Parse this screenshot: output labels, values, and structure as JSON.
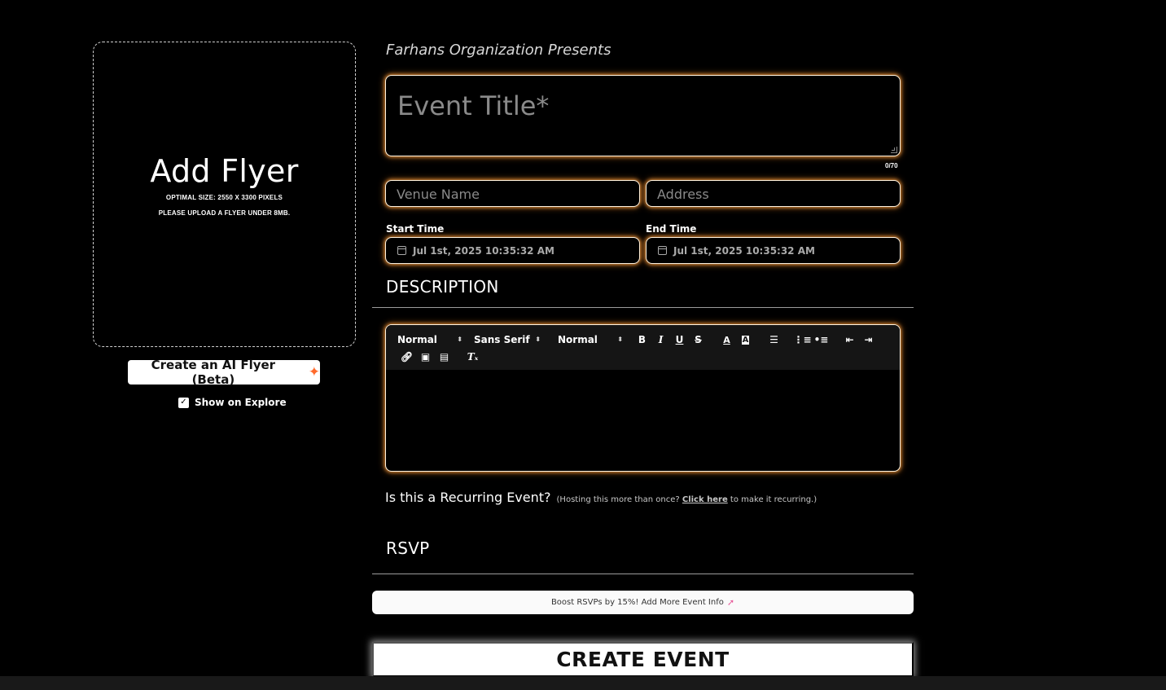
{
  "flyer": {
    "title": "Add Flyer",
    "size_hint": "OPTIMAL SIZE: 2550 X 3300 PIXELS",
    "upload_hint": "PLEASE UPLOAD A FLYER UNDER 8MB.",
    "ai_button_label": "Create an AI Flyer (Beta)",
    "ai_button_icon": "sparkle-icon",
    "show_on_explore_label": "Show on Explore",
    "show_on_explore_checked": true
  },
  "form": {
    "presents_text": "Farhans Organization Presents",
    "title_placeholder": "Event Title*",
    "title_counter": "0/70",
    "venue_placeholder": "Venue Name",
    "address_placeholder": "Address",
    "start_label": "Start Time",
    "start_value": "Jul 1st, 2025 10:35:32 AM",
    "end_label": "End Time",
    "end_value": "Jul 1st, 2025 10:35:32 AM",
    "accent_glow_color": "#ffa03c"
  },
  "description": {
    "heading": "DESCRIPTION",
    "toolbar": {
      "header_select": "Normal",
      "font_select": "Sans Serif",
      "size_select": "Normal",
      "bold": "B",
      "italic": "I",
      "underline": "U",
      "strike": "S",
      "color": "A",
      "background": "A"
    }
  },
  "recurring": {
    "question": "Is this a Recurring Event?",
    "note_prefix": "(Hosting this more than once?",
    "link_text": "Click here",
    "note_suffix": "to make it recurring.)"
  },
  "rsvp": {
    "heading": "RSVP",
    "boost_text": "Boost RSVPs by 15%! Add More Event Info",
    "boost_icon": "rocket-icon"
  },
  "submit": {
    "label": "CREATE EVENT"
  }
}
